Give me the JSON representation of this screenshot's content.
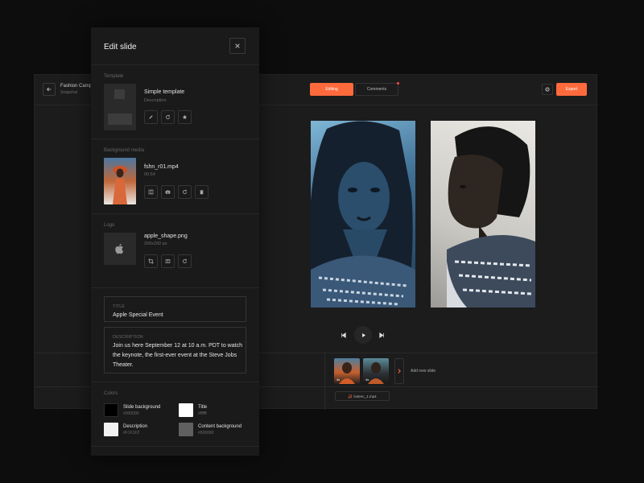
{
  "app": {
    "project_name": "Fashion Camp",
    "project_sub": "Snapchat",
    "tabs": [
      {
        "label": "Editing"
      },
      {
        "label": "Comments"
      }
    ],
    "export_label": "Export",
    "timeline": {
      "slides": [
        {
          "duration": "4s"
        },
        {
          "duration": "4s"
        }
      ],
      "add_slide_label": "Add new slide",
      "audio_file": "lostrec_1.mp4"
    },
    "colors": {
      "accent": "#ff6a3d",
      "background": "#1c1c1d"
    }
  },
  "panel": {
    "title": "Edit slide",
    "template": {
      "section_label": "Template",
      "name": "Simple template",
      "sub": "Description"
    },
    "background_media": {
      "section_label": "Background media",
      "file": "fshn_r01.mp4",
      "duration": "00:54"
    },
    "logo": {
      "section_label": "Logo",
      "file": "apple_shape.png",
      "size": "200x200 px"
    },
    "title_field": {
      "label": "TITLE",
      "value": "Apple Special Event"
    },
    "description_field": {
      "label": "DESCRIPTION",
      "value": "Join us here September 12 at 10 a.m. PDT to watch the keynote, the first-ever event at the Steve Jobs Theater."
    },
    "colors": {
      "section_label": "Colors",
      "items": [
        {
          "name": "Slide background",
          "hex": "#000000",
          "swatch": "#000000"
        },
        {
          "name": "Title",
          "hex": "#ffffff",
          "swatch": "#ffffff"
        },
        {
          "name": "Description",
          "hex": "#F1F1F2",
          "swatch": "#F1F1F2"
        },
        {
          "name": "Content background",
          "hex": "#606060",
          "swatch": "#606060"
        }
      ]
    }
  }
}
